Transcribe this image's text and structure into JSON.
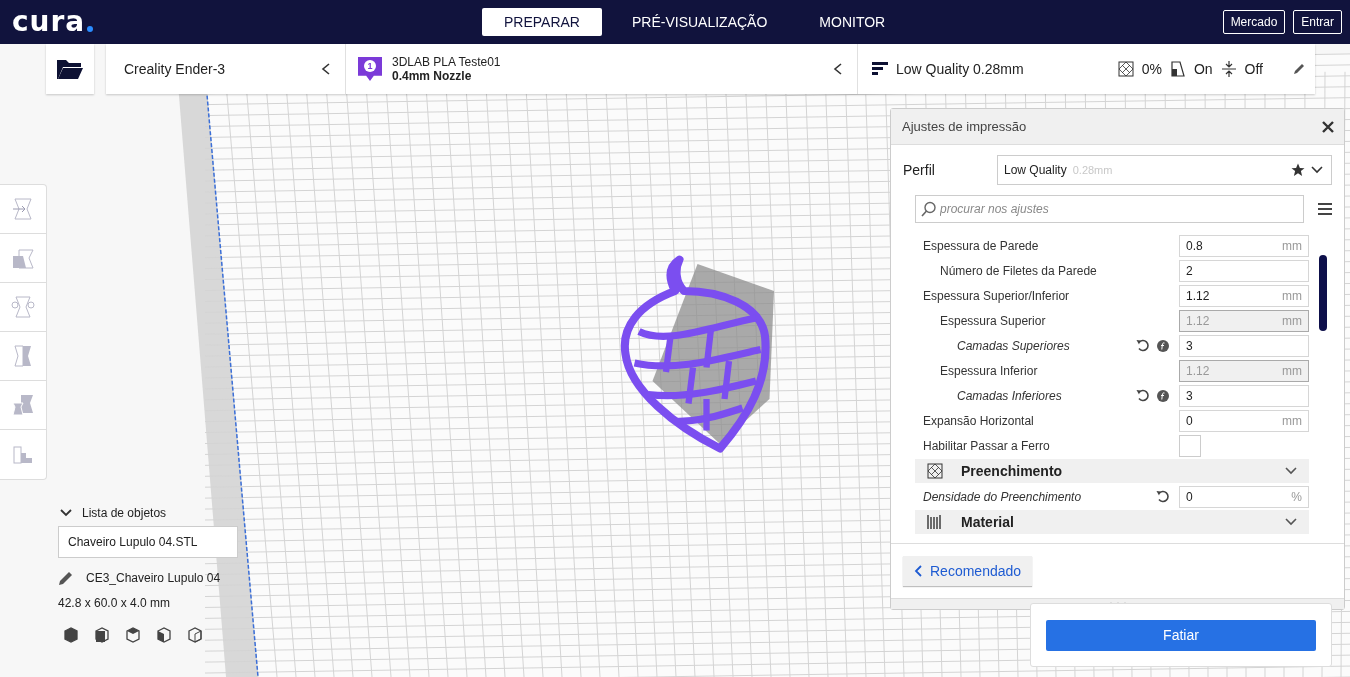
{
  "header": {
    "logo": "cura",
    "tabs": [
      {
        "label": "PREPARAR",
        "selected": true
      },
      {
        "label": "PRÉ-VISUALIZAÇÃO",
        "selected": false
      },
      {
        "label": "MONITOR",
        "selected": false
      }
    ],
    "buttons": [
      "Mercado",
      "Entrar"
    ]
  },
  "toolbar": {
    "machine": "Creality Ender-3",
    "extruder": {
      "number": "1",
      "material": "3DLAB PLA Teste01",
      "nozzle": "0.4mm Nozzle"
    },
    "quality": "Low Quality 0.28mm",
    "infill": "0%",
    "support": "On",
    "adhesion": "Off"
  },
  "object_panel": {
    "title": "Lista de objetos",
    "expanded": true,
    "objects": [
      "Chaveiro Lupulo 04.STL"
    ],
    "job_name": "CE3_Chaveiro Lupulo 04",
    "dimensions": "42.8 x 60.0 x 4.0 mm"
  },
  "settings_panel": {
    "title": "Ajustes de impressão",
    "profile_label": "Perfil",
    "profile": "Low Quality",
    "profile_detail": "0.28mm",
    "search": {
      "placeholder": "procurar nos ajustes"
    },
    "settings": [
      {
        "kind": "field",
        "label": "Espessura de Parede",
        "value": "0.8",
        "unit": "mm",
        "disabled": false,
        "modified": false,
        "formula": false,
        "children": [
          {
            "kind": "field",
            "label": "Número de Filetes da Parede",
            "value": "2",
            "disabled": false,
            "modified": false,
            "formula": false
          }
        ]
      },
      {
        "kind": "field",
        "label": "Espessura Superior/Inferior",
        "value": "1.12",
        "unit": "mm",
        "disabled": false,
        "modified": false,
        "formula": false,
        "children": [
          {
            "kind": "field",
            "label": "Espessura Superior",
            "value": "1.12",
            "unit": "mm",
            "disabled": true,
            "modified": false,
            "formula": false,
            "children": [
              {
                "kind": "field",
                "label": "Camadas Superiores",
                "value": "3",
                "disabled": false,
                "modified": true,
                "formula": true
              }
            ]
          },
          {
            "kind": "field",
            "label": "Espessura Inferior",
            "value": "1.12",
            "unit": "mm",
            "disabled": true,
            "modified": false,
            "formula": false,
            "children": [
              {
                "kind": "field",
                "label": "Camadas Inferiores",
                "value": "3",
                "disabled": false,
                "modified": true,
                "formula": true
              }
            ]
          }
        ]
      },
      {
        "kind": "field",
        "label": "Expansão Horizontal",
        "value": "0",
        "unit": "mm",
        "disabled": false,
        "modified": false,
        "formula": false
      },
      {
        "kind": "checkbox",
        "label": "Habilitar Passar a Ferro",
        "checked": false
      },
      {
        "kind": "section",
        "label": "Preenchimento"
      },
      {
        "kind": "field",
        "label": "Densidade do Preenchimento",
        "value": "0",
        "unit": "%",
        "disabled": false,
        "modified": true,
        "formula": false
      },
      {
        "kind": "section",
        "label": "Material"
      }
    ],
    "mode_button": "Recomendado"
  },
  "slice_button": "Fatiar"
}
